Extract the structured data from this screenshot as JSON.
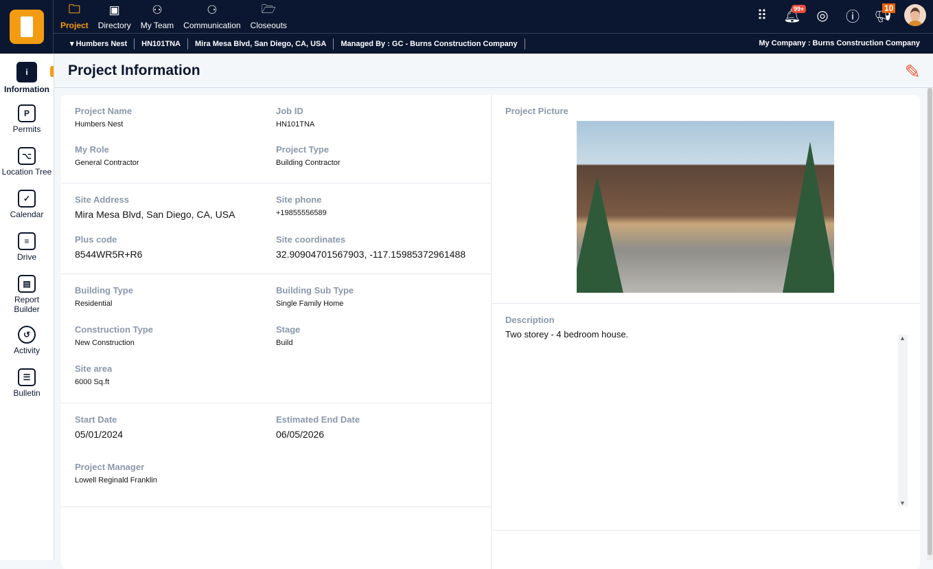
{
  "nav": {
    "items": [
      {
        "label": "Project",
        "icon": "folder-icon",
        "active": true
      },
      {
        "label": "Directory",
        "icon": "contacts-icon"
      },
      {
        "label": "My Team",
        "icon": "team-icon"
      },
      {
        "label": "Communication",
        "icon": "communication-icon"
      },
      {
        "label": "Closeouts",
        "icon": "folder-check-icon"
      }
    ]
  },
  "breadcrumb": {
    "project": "Humbers Nest",
    "job_id": "HN101TNA",
    "address": "Mira Mesa Blvd, San Diego, CA, USA",
    "managed_by": "Managed By : GC - Burns Construction Company",
    "my_company": "My Company : Burns Construction Company"
  },
  "badges": {
    "notifications": "99+",
    "announcements": "10"
  },
  "sidebar": {
    "items": [
      {
        "label": "Information",
        "glyph": "i"
      },
      {
        "label": "Permits",
        "glyph": "P"
      },
      {
        "label": "Location Tree",
        "glyph": "⌥"
      },
      {
        "label": "Calendar",
        "glyph": "✓"
      },
      {
        "label": "Drive",
        "glyph": "≡"
      },
      {
        "label": "Report Builder",
        "glyph": "▤"
      },
      {
        "label": "Activity",
        "glyph": "↺"
      },
      {
        "label": "Bulletin",
        "glyph": "☰"
      }
    ]
  },
  "page": {
    "title": "Project Information"
  },
  "fields": {
    "project_name": {
      "label": "Project Name",
      "value": "Humbers Nest"
    },
    "job_id": {
      "label": "Job ID",
      "value": "HN101TNA"
    },
    "my_role": {
      "label": "My Role",
      "value": "General Contractor"
    },
    "project_type": {
      "label": "Project Type",
      "value": "Building Contractor"
    },
    "site_address": {
      "label": "Site Address",
      "value": "Mira Mesa Blvd, San Diego, CA, USA"
    },
    "site_phone": {
      "label": "Site phone",
      "value": "+19855556589"
    },
    "plus_code": {
      "label": "Plus code",
      "value": "8544WR5R+R6"
    },
    "site_coordinates": {
      "label": "Site coordinates",
      "value": "32.90904701567903, -117.15985372961488"
    },
    "building_type": {
      "label": "Building Type",
      "value": "Residential"
    },
    "building_sub_type": {
      "label": "Building Sub Type",
      "value": "Single Family Home"
    },
    "construction_type": {
      "label": "Construction Type",
      "value": "New Construction"
    },
    "stage": {
      "label": "Stage",
      "value": "Build"
    },
    "site_area": {
      "label": "Site area",
      "value": "6000 Sq.ft"
    },
    "start_date": {
      "label": "Start Date",
      "value": "05/01/2024"
    },
    "end_date": {
      "label": "Estimated End Date",
      "value": "06/05/2026"
    },
    "project_manager": {
      "label": "Project Manager",
      "value": "Lowell Reginald Franklin"
    }
  },
  "picture": {
    "label": "Project Picture"
  },
  "description": {
    "label": "Description",
    "value": "Two storey - 4 bedroom house."
  }
}
